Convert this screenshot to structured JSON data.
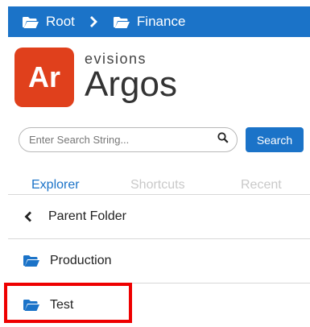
{
  "breadcrumb": {
    "items": [
      {
        "label": "Root",
        "icon": "folder-open-icon"
      },
      {
        "label": "Finance",
        "icon": "folder-open-icon"
      }
    ],
    "separator_icon": "chevron-right-icon"
  },
  "branding": {
    "logo_text": "Ar",
    "maker": "evisions",
    "product": "Argos",
    "logo_color": "#e0401c"
  },
  "search": {
    "placeholder": "Enter Search String...",
    "value": "",
    "button_label": "Search"
  },
  "tabs": [
    {
      "label": "Explorer",
      "active": true
    },
    {
      "label": "Shortcuts",
      "active": false
    },
    {
      "label": "Recent",
      "active": false
    }
  ],
  "list": {
    "parent_label": "Parent Folder",
    "items": [
      {
        "label": "Production",
        "icon": "folder-open-icon"
      },
      {
        "label": "Test",
        "icon": "folder-open-icon"
      }
    ]
  },
  "colors": {
    "accent": "#1b73c8",
    "highlight": "#ee0000"
  }
}
